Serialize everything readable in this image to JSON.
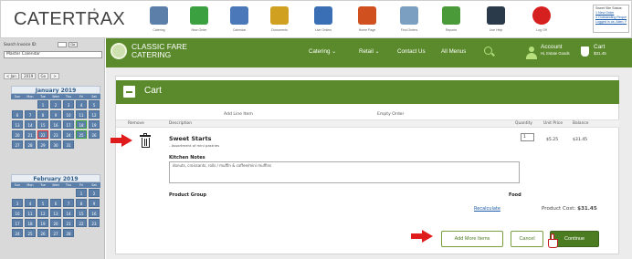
{
  "app": {
    "logo": "CATERTRAX",
    "logo_mark": "®"
  },
  "toolbar": {
    "items": [
      {
        "icon": "catering-icon",
        "label": "Catering",
        "color": "#5b7fa8"
      },
      {
        "icon": "new-order-icon",
        "label": "New Order",
        "color": "#3aa040"
      },
      {
        "icon": "calendar-icon",
        "label": "Calendar",
        "color": "#4a78b8"
      },
      {
        "icon": "document-icon",
        "label": "Documents",
        "color": "#d0a020"
      },
      {
        "icon": "live-orders-icon",
        "label": "Live Orders",
        "color": "#3b6fb5"
      },
      {
        "icon": "home-icon",
        "label": "Home Page",
        "color": "#d05020"
      },
      {
        "icon": "find-orders-icon",
        "label": "Find Orders",
        "color": "#7a9fc0"
      },
      {
        "icon": "reports-icon",
        "label": "Reports",
        "color": "#4a9a3a"
      },
      {
        "icon": "live-help-icon",
        "label": "Live Help",
        "color": "#2a3a4a"
      },
      {
        "icon": "log-off-icon",
        "label": "Log Off",
        "color": "#d62020"
      }
    ]
  },
  "help": {
    "lines": [
      "Sweet Site Status:",
      "1 New Order",
      "4 Outstanding Requests",
      "Logged in as: Allen, Renah"
    ]
  },
  "sidebar": {
    "search_label": "Search Invoice ID:",
    "go_label": "Go",
    "calendar_select": "Master Calendar",
    "nav": [
      "< Jan",
      "2019",
      "Go",
      ">"
    ],
    "calendars": [
      {
        "title": "January 2019",
        "dow": [
          "Sun",
          "Mon",
          "Tue",
          "Wed",
          "Thu",
          "Fri",
          "Sat"
        ],
        "days": [
          "",
          "",
          "1",
          "2",
          "3",
          "4",
          "5",
          "6",
          "7",
          "8",
          "9",
          "10",
          "11",
          "12",
          "13",
          "14",
          "15",
          "16",
          "17",
          "18",
          "19",
          "20",
          "21",
          "22",
          "23",
          "24",
          "25",
          "26",
          "27",
          "28",
          "29",
          "30",
          "31",
          "",
          ""
        ]
      },
      {
        "title": "February 2019",
        "dow": [
          "Sun",
          "Mon",
          "Tue",
          "Wed",
          "Thu",
          "Fri",
          "Sat"
        ],
        "days": [
          "",
          "",
          "",
          "",
          "",
          "1",
          "2",
          "3",
          "4",
          "5",
          "6",
          "7",
          "8",
          "9",
          "10",
          "11",
          "12",
          "13",
          "14",
          "15",
          "16",
          "17",
          "18",
          "19",
          "20",
          "21",
          "22",
          "23",
          "24",
          "25",
          "26",
          "27",
          "28",
          "",
          ""
        ]
      }
    ]
  },
  "header": {
    "brand_line1": "CLASSIC FARE",
    "brand_line2": "CATERING",
    "menu": [
      "Catering ⌄",
      "Retail ⌄",
      "Contact Us",
      "All Menus"
    ],
    "account_label": "Account",
    "account_sub": "Hi, Estate Goods",
    "cart_label": "Cart",
    "cart_amount": "$31.45"
  },
  "cart": {
    "title": "Cart",
    "add_line_item": "Add Line Item",
    "empty_order": "Empty Order",
    "columns": {
      "remove": "Remove",
      "description": "Description",
      "quantity": "Quantity",
      "unit_price": "Unit Price",
      "balance": "Balance"
    },
    "item": {
      "name": "Sweet Starts",
      "sub": "- Assortment of mini pastries",
      "quantity": "1",
      "unit_price": "$5.25",
      "balance": "$31.45"
    },
    "kitchen_notes_label": "Kitchen Notes",
    "kitchen_notes_value": "donuts, croissants, rolls / muffin & coffee/mini muffins",
    "product_group_label": "Product Group",
    "product_group_value": "Food",
    "recalculate": "Recalculate",
    "product_cost_label": "Product Cost:",
    "product_cost_value": "$31.45",
    "buttons": {
      "add_more": "Add More Items",
      "cancel": "Cancel",
      "continue": "Continue"
    }
  },
  "colors": {
    "brand_green": "#5a8a2b",
    "annotation_red": "#e01b1b",
    "link_blue": "#1a5aa8"
  }
}
